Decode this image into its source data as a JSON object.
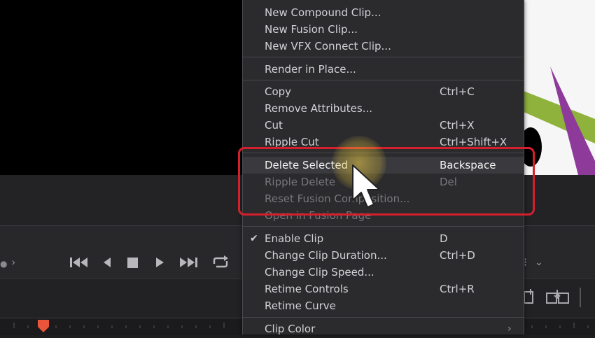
{
  "menu": {
    "items": [
      {
        "label": "New Compound Clip...",
        "shortcut": ""
      },
      {
        "label": "New Fusion Clip...",
        "shortcut": ""
      },
      {
        "label": "New VFX Connect Clip...",
        "shortcut": ""
      },
      {
        "label": "Render in Place...",
        "shortcut": ""
      },
      {
        "label": "Copy",
        "shortcut": "Ctrl+C"
      },
      {
        "label": "Remove Attributes...",
        "shortcut": ""
      },
      {
        "label": "Cut",
        "shortcut": "Ctrl+X"
      },
      {
        "label": "Ripple Cut",
        "shortcut": "Ctrl+Shift+X"
      },
      {
        "label": "Delete Selected",
        "shortcut": "Backspace"
      },
      {
        "label": "Ripple Delete",
        "shortcut": "Del"
      },
      {
        "label": "Reset Fusion Composition...",
        "shortcut": ""
      },
      {
        "label": "Open in Fusion Page",
        "shortcut": ""
      },
      {
        "label": "Enable Clip",
        "shortcut": "D",
        "checked": true
      },
      {
        "label": "Change Clip Duration...",
        "shortcut": "Ctrl+D"
      },
      {
        "label": "Change Clip Speed...",
        "shortcut": ""
      },
      {
        "label": "Retime Controls",
        "shortcut": "Ctrl+R"
      },
      {
        "label": "Retime Curve",
        "shortcut": ""
      },
      {
        "label": "Clip Color",
        "shortcut": "",
        "submenu": true
      }
    ]
  },
  "colors": {
    "menu_bg": "#2b2b2e",
    "highlight": "#3a3a3e",
    "callout_border": "#d61f2c",
    "playhead": "#e8553a",
    "graphic_green": "#8fb23c",
    "graphic_purple": "#8e3a9a"
  },
  "icons": {
    "transport": [
      "go-to-start-icon",
      "step-back-icon",
      "stop-icon",
      "play-icon",
      "go-to-end-icon",
      "loop-icon"
    ],
    "menu": [
      "checkmark-icon",
      "submenu-arrow-icon"
    ],
    "cursor": "mouse-pointer-icon"
  }
}
